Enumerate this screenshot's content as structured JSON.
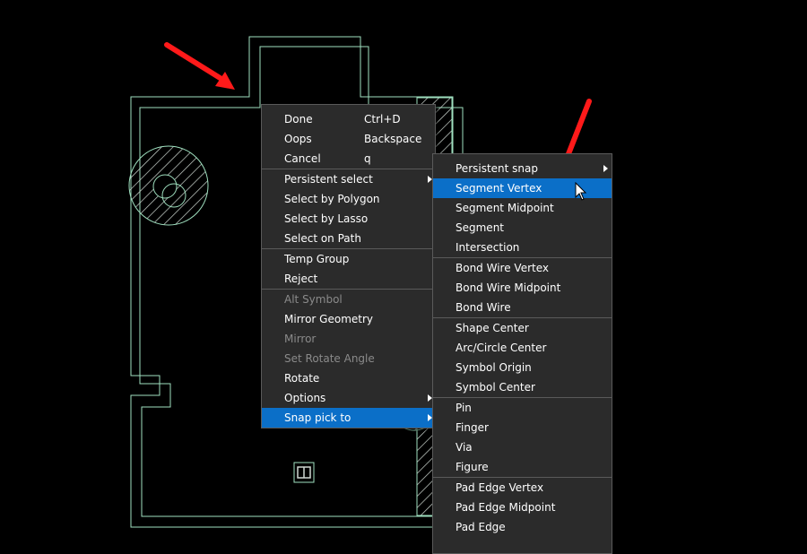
{
  "main_menu": {
    "items": [
      {
        "label": "Done",
        "shortcut": "Ctrl+D",
        "enabled": true
      },
      {
        "label": "Oops",
        "shortcut": "Backspace",
        "enabled": true
      },
      {
        "label": "Cancel",
        "shortcut": "q",
        "enabled": true
      },
      {
        "separator": true
      },
      {
        "label": "Persistent select",
        "submenu": true,
        "enabled": true
      },
      {
        "label": "Select by Polygon",
        "enabled": true
      },
      {
        "label": "Select by Lasso",
        "enabled": true
      },
      {
        "label": "Select on Path",
        "enabled": true
      },
      {
        "separator": true
      },
      {
        "label": "Temp Group",
        "enabled": true
      },
      {
        "label": "Reject",
        "enabled": true
      },
      {
        "separator": true
      },
      {
        "label": "Alt Symbol",
        "enabled": false
      },
      {
        "label": "Mirror Geometry",
        "enabled": true
      },
      {
        "label": "Mirror",
        "enabled": false
      },
      {
        "label": "Set Rotate Angle",
        "enabled": false
      },
      {
        "label": "Rotate",
        "enabled": true
      },
      {
        "label": "Options",
        "submenu": true,
        "enabled": true
      },
      {
        "label": "Snap pick to",
        "submenu": true,
        "enabled": true,
        "highlighted": true
      }
    ]
  },
  "snap_menu": {
    "items": [
      {
        "label": "Persistent snap",
        "submenu": true,
        "enabled": true
      },
      {
        "label": "Segment Vertex",
        "enabled": true,
        "highlighted": true
      },
      {
        "label": "Segment Midpoint",
        "enabled": true
      },
      {
        "label": "Segment",
        "enabled": true
      },
      {
        "label": "Intersection",
        "enabled": true
      },
      {
        "separator": true
      },
      {
        "label": "Bond Wire Vertex",
        "enabled": true
      },
      {
        "label": "Bond Wire Midpoint",
        "enabled": true
      },
      {
        "label": "Bond Wire",
        "enabled": true
      },
      {
        "separator": true
      },
      {
        "label": "Shape Center",
        "enabled": true
      },
      {
        "label": "Arc/Circle Center",
        "enabled": true
      },
      {
        "label": "Symbol Origin",
        "enabled": true
      },
      {
        "label": "Symbol Center",
        "enabled": true
      },
      {
        "separator": true
      },
      {
        "label": "Pin",
        "enabled": true
      },
      {
        "label": "Finger",
        "enabled": true
      },
      {
        "label": "Via",
        "enabled": true
      },
      {
        "label": "Figure",
        "enabled": true
      },
      {
        "separator": true
      },
      {
        "label": "Pad Edge Vertex",
        "enabled": true
      },
      {
        "label": "Pad Edge Midpoint",
        "enabled": true
      },
      {
        "label": "Pad Edge",
        "enabled": true
      }
    ]
  },
  "colors": {
    "canvas_background": "#000000",
    "outline": "#9fe0bf",
    "menu_background": "#2b2b2b",
    "menu_highlight": "#0b6fc8",
    "menu_text": "#ffffff",
    "menu_disabled_text": "#8a8a8a",
    "annotation_arrow": "#ff1a1a"
  }
}
